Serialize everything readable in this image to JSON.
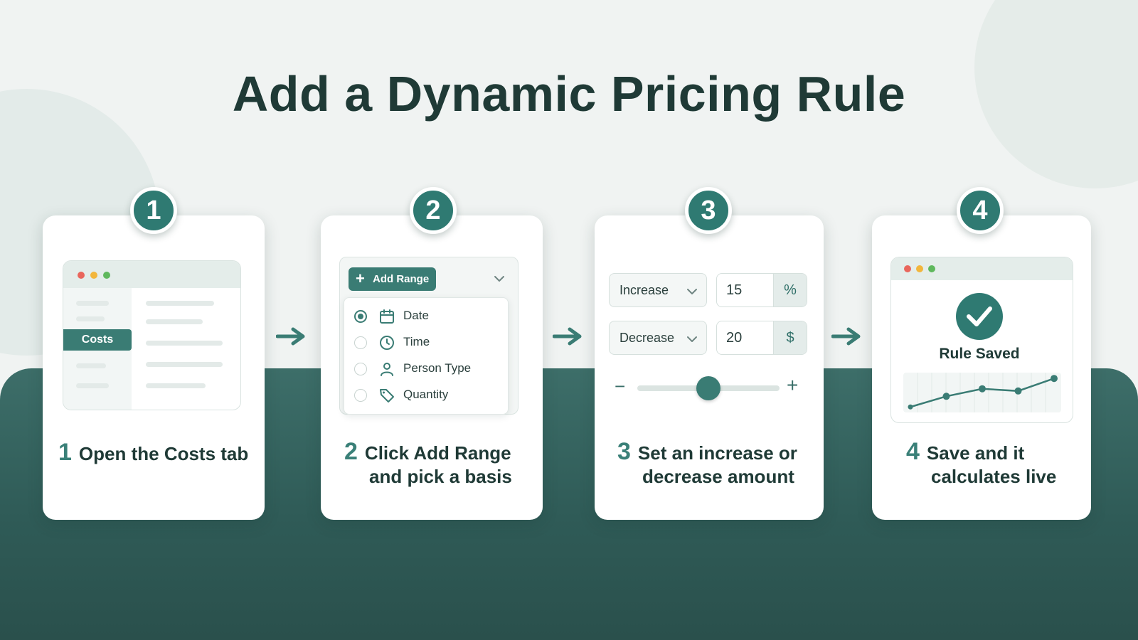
{
  "title": "Add a Dynamic Pricing Rule",
  "colors": {
    "accent": "#2f7a72",
    "dark": "#1f3a36",
    "band": "#34625d"
  },
  "steps": [
    {
      "badge": "1",
      "num": "1",
      "caption_line1": "Open the Costs tab",
      "caption_line2": ""
    },
    {
      "badge": "2",
      "num": "2",
      "caption_line1": "Click Add Range",
      "caption_line2": "and pick a basis"
    },
    {
      "badge": "3",
      "num": "3",
      "caption_line1": "Set an increase or",
      "caption_line2": "decrease amount"
    },
    {
      "badge": "4",
      "num": "4",
      "caption_line1": "Save and it",
      "caption_line2": "calculates live"
    }
  ],
  "card1": {
    "active_tab": "Costs"
  },
  "card2": {
    "button_label": "Add Range",
    "options": [
      {
        "label": "Date",
        "icon": "calendar-icon",
        "selected": true
      },
      {
        "label": "Time",
        "icon": "clock-icon",
        "selected": false
      },
      {
        "label": "Person Type",
        "icon": "person-icon",
        "selected": false
      },
      {
        "label": "Quantity",
        "icon": "tag-icon",
        "selected": false
      }
    ]
  },
  "card3": {
    "rows": [
      {
        "mode": "Increase",
        "value": "15",
        "unit": "%"
      },
      {
        "mode": "Decrease",
        "value": "20",
        "unit": "$"
      }
    ],
    "slider_minus": "−",
    "slider_plus": "+",
    "slider_level": 0.5
  },
  "card4": {
    "status": "Rule Saved",
    "trend_points": [
      0.04,
      0.38,
      0.62,
      0.55,
      0.95
    ]
  }
}
